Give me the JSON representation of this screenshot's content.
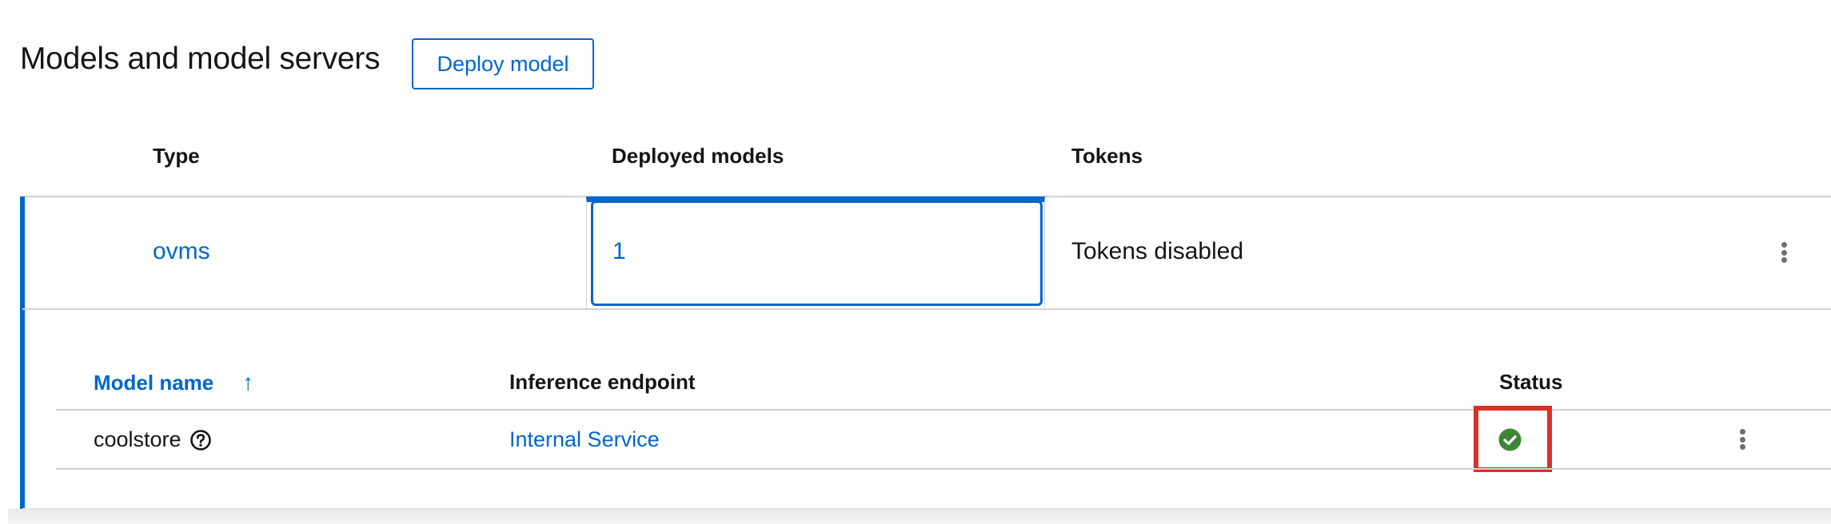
{
  "header": {
    "title": "Models and model servers",
    "deploy_label": "Deploy model"
  },
  "colors": {
    "accent": "#0066cc",
    "success": "#3e8635",
    "highlight": "#d93126"
  },
  "server_table": {
    "columns": [
      "Type",
      "Deployed models",
      "Tokens"
    ],
    "row": {
      "type": "ovms",
      "deployed_models": "1",
      "tokens": "Tokens disabled",
      "actions_icon": "kebab-icon"
    }
  },
  "models_table": {
    "columns": [
      "Model name",
      "Inference endpoint",
      "Status"
    ],
    "sort_icon": "sort-ascending-icon",
    "rows": [
      {
        "name": "coolstore",
        "help_icon": "question-circle-icon",
        "endpoint": "Internal Service",
        "status_icon": "check-circle-icon",
        "actions_icon": "kebab-icon"
      }
    ]
  }
}
